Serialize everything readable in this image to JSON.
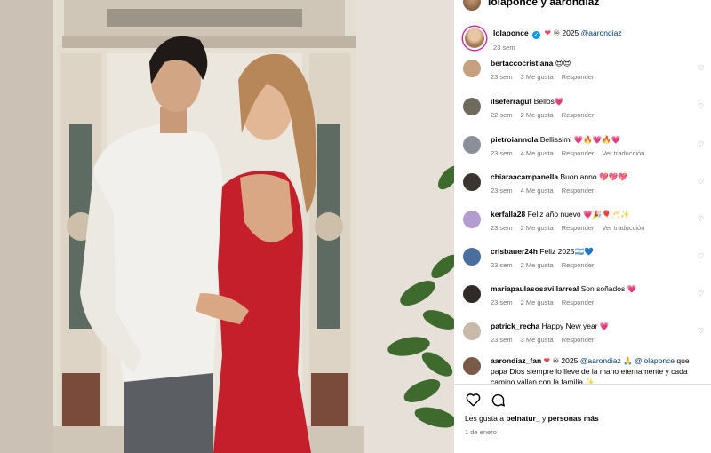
{
  "header": {
    "users": "lolaponce y aarondiaz"
  },
  "caption": {
    "username": "lolaponce",
    "text": "♾ 2025",
    "mention": "@aarondiaz",
    "time": "23 sem"
  },
  "comments": [
    {
      "username": "bertaccocristiana",
      "text": "😍😍",
      "time": "23 sem",
      "likes": "3 Me gusta",
      "reply": "Responder",
      "translate": "",
      "avatar_color": "#c4a080"
    },
    {
      "username": "ilseferragut",
      "text": "Bellos",
      "text_emoji": "💗",
      "time": "22 sem",
      "likes": "2 Me gusta",
      "reply": "Responder",
      "translate": "",
      "avatar_color": "#6f6a5e"
    },
    {
      "username": "pietroiannola",
      "text": "Bellissimi",
      "text_emoji": "💗🔥💗🔥💗",
      "time": "23 sem",
      "likes": "4 Me gusta",
      "reply": "Responder",
      "translate": "Ver traducción",
      "avatar_color": "#8a8f99"
    },
    {
      "username": "chiaraacampanella",
      "text": "Buon anno",
      "text_emoji": "💖💖💖",
      "time": "23 sem",
      "likes": "4 Me gusta",
      "reply": "Responder",
      "translate": "",
      "avatar_color": "#3b3532"
    },
    {
      "username": "kerfalla28",
      "text": "Feliz año nuevo",
      "text_emoji": "💗🎉🎈🥂✨",
      "time": "23 sem",
      "likes": "2 Me gusta",
      "reply": "Responder",
      "translate": "Ver traducción",
      "avatar_color": "#b59cd0"
    },
    {
      "username": "crisbauer24h",
      "text": "Feliz 2025🇦🇷💙",
      "text_emoji": "",
      "time": "23 sem",
      "likes": "2 Me gusta",
      "reply": "Responder",
      "translate": "",
      "avatar_color": "#4a6f9e"
    },
    {
      "username": "mariapaulasosavillarreal",
      "text": "Son soñados",
      "text_emoji": "💗",
      "time": "23 sem",
      "likes": "2 Me gusta",
      "reply": "Responder",
      "translate": "",
      "avatar_color": "#2f2a28"
    },
    {
      "username": "patrick_recha",
      "text": "Happy New year",
      "text_emoji": "💗",
      "time": "23 sem",
      "likes": "3 Me gusta",
      "reply": "Responder",
      "translate": "",
      "avatar_color": "#c9b9a8"
    },
    {
      "username": "aarondiaz_fan",
      "text": "♾ 2025",
      "mention1": "@aarondiaz",
      "mention2": "@lolaponce",
      "text2": "que papa Dios siempre lo lleve de la mano eternamente y cada camino vallan con la familia.",
      "time": "",
      "likes": "",
      "reply": "",
      "translate": "",
      "avatar_color": "#7a5a48"
    }
  ],
  "footer": {
    "likes_prefix": "Les gusta a",
    "liker": "belnatur_",
    "likes_mid": "y",
    "likes_more": "personas más",
    "date": "1 de enero"
  },
  "icons": [
    "heart-icon",
    "comment-icon",
    "verified-icon"
  ],
  "colors": {
    "accent": "#0095f6",
    "mention": "#00376b",
    "heart": "#ed4956",
    "muted": "#737373"
  }
}
